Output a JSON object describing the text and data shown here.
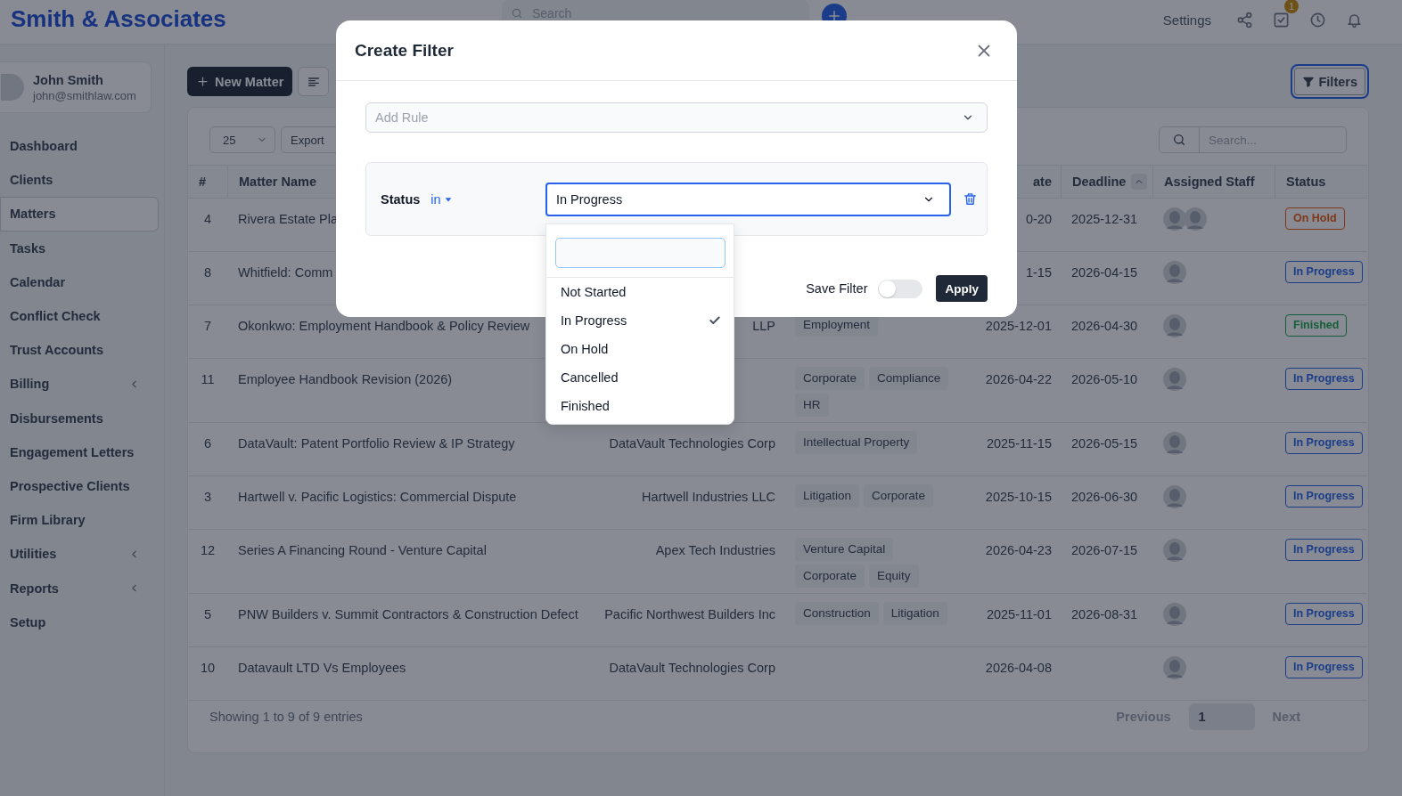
{
  "header": {
    "logo": "Smith & Associates",
    "search": {
      "placeholder": "Search"
    },
    "settings": "Settings",
    "tasks_badge": "1"
  },
  "sidebar": {
    "user": {
      "name": "John Smith",
      "email": "john@smithlaw.com"
    },
    "items": [
      {
        "label": "Dashboard",
        "selected": false,
        "expandable": false
      },
      {
        "label": "Clients",
        "selected": false,
        "expandable": false
      },
      {
        "label": "Matters",
        "selected": true,
        "expandable": false
      },
      {
        "label": "Tasks",
        "selected": false,
        "expandable": false
      },
      {
        "label": "Calendar",
        "selected": false,
        "expandable": false
      },
      {
        "label": "Conflict Check",
        "selected": false,
        "expandable": false
      },
      {
        "label": "Trust Accounts",
        "selected": false,
        "expandable": false
      },
      {
        "label": "Billing",
        "selected": false,
        "expandable": true
      },
      {
        "label": "Disbursements",
        "selected": false,
        "expandable": false
      },
      {
        "label": "Engagement Letters",
        "selected": false,
        "expandable": false
      },
      {
        "label": "Prospective Clients",
        "selected": false,
        "expandable": false
      },
      {
        "label": "Firm Library",
        "selected": false,
        "expandable": false
      },
      {
        "label": "Utilities",
        "selected": false,
        "expandable": true
      },
      {
        "label": "Reports",
        "selected": false,
        "expandable": true
      },
      {
        "label": "Setup",
        "selected": false,
        "expandable": false
      }
    ]
  },
  "toolbar": {
    "new_matter": "New Matter",
    "filters": {
      "label": "Filters",
      "active": true
    }
  },
  "table": {
    "page_size": "25",
    "export": "Export",
    "search": {
      "placeholder": "Search..."
    },
    "columns": [
      {
        "label": "#",
        "sorted": false
      },
      {
        "label": "Matter Name",
        "sorted": false
      },
      null,
      null,
      {
        "label": "ate",
        "sorted": false
      },
      {
        "label": "Deadline",
        "sorted": true
      },
      {
        "label": "Assigned Staff",
        "sorted": false
      },
      {
        "label": "Status",
        "sorted": false
      }
    ],
    "rows": [
      {
        "number": "4",
        "matter": "Rivera Estate Pla",
        "start": "0-20",
        "deadline": "2025-12-31",
        "staff": [
          {
            "kind": "silhouette"
          },
          {
            "kind": "silhouette"
          }
        ],
        "status": {
          "label": "On Hold",
          "color": "#7e381a"
        }
      },
      {
        "number": "8",
        "matter": "Whitfield: Comm",
        "start": "1-15",
        "deadline": "2026-04-15",
        "staff": [
          {
            "kind": "silhouette"
          }
        ],
        "status": {
          "label": "In Progress",
          "color": "#1b3d89"
        }
      },
      {
        "number": "7",
        "matter": "Okonkwo: Employment Handbook & Policy Review",
        "client": "LLP",
        "tags": [
          "Employment"
        ],
        "start": "2025-12-01",
        "deadline": "2026-04-30",
        "staff": [
          {
            "kind": "silhouette"
          }
        ],
        "status": {
          "label": "Finished",
          "color": "#145e38"
        }
      },
      {
        "number": "11",
        "matter": "Employee Handbook Revision (2026)",
        "tags": [
          "Corporate",
          "Compliance",
          "HR"
        ],
        "start": "2026-04-22",
        "deadline": "2026-05-10",
        "staff": [
          {
            "kind": "silhouette"
          }
        ],
        "status": {
          "label": "In Progress",
          "color": "#1b3d89"
        }
      },
      {
        "number": "6",
        "matter": "DataVault: Patent Portfolio Review & IP Strategy",
        "client": "DataVault Technologies Corp",
        "tags": [
          "Intellectual Property"
        ],
        "start": "2025-11-15",
        "deadline": "2026-05-15",
        "staff": [
          {
            "kind": "silhouette"
          }
        ],
        "status": {
          "label": "In Progress",
          "color": "#1b3d89"
        }
      },
      {
        "number": "3",
        "matter": "Hartwell v. Pacific Logistics: Commercial Dispute",
        "client": "Hartwell Industries LLC",
        "tags": [
          "Litigation",
          "Corporate"
        ],
        "start": "2025-10-15",
        "deadline": "2026-06-30",
        "staff": [
          {
            "kind": "silhouette"
          }
        ],
        "status": {
          "label": "In Progress",
          "color": "#1b3d89"
        }
      },
      {
        "number": "12",
        "matter": "Series A Financing Round - Venture Capital",
        "client": "Apex Tech Industries",
        "tags": [
          "Venture Capital",
          "Corporate",
          "Equity"
        ],
        "start": "2026-04-23",
        "deadline": "2026-07-15",
        "staff": [
          {
            "kind": "silhouette"
          }
        ],
        "status": {
          "label": "In Progress",
          "color": "#1b3d89"
        }
      },
      {
        "number": "5",
        "matter": "PNW Builders v. Summit Contractors & Construction Defect",
        "client": "Pacific Northwest Builders Inc",
        "tags": [
          "Construction",
          "Litigation"
        ],
        "start": "2025-11-01",
        "deadline": "2026-08-31",
        "staff": [
          {
            "kind": "silhouette"
          }
        ],
        "status": {
          "label": "In Progress",
          "color": "#1b3d89"
        }
      },
      {
        "number": "10",
        "matter": "Datavault LTD Vs Employees",
        "client": "DataVault Technologies Corp",
        "start": "2026-04-08",
        "staff": [
          {
            "kind": "silhouette"
          }
        ],
        "status": {
          "label": "In Progress",
          "color": "#1b3d89"
        }
      }
    ],
    "footer": {
      "info": "Showing 1 to 9 of 9 entries",
      "pages": [
        {
          "label": "Previous",
          "kind": "nav",
          "selected": false,
          "disabled": true
        },
        {
          "label": "1",
          "kind": "page",
          "selected": true,
          "disabled": false
        },
        {
          "label": "Next",
          "kind": "nav",
          "selected": false,
          "disabled": true
        }
      ]
    }
  },
  "modal": {
    "title": "Create Filter",
    "add_rule": {
      "placeholder": "Add Rule"
    },
    "rule": {
      "field": "Status",
      "operator": "in",
      "value": "In Progress",
      "options": [
        {
          "label": "Not Started",
          "selected": false
        },
        {
          "label": "In Progress",
          "selected": true
        },
        {
          "label": "On Hold",
          "selected": false
        },
        {
          "label": "Cancelled",
          "selected": false
        },
        {
          "label": "Finished",
          "selected": false
        }
      ]
    },
    "save_filter": {
      "label": "Save Filter",
      "on": false
    },
    "apply": "Apply"
  }
}
